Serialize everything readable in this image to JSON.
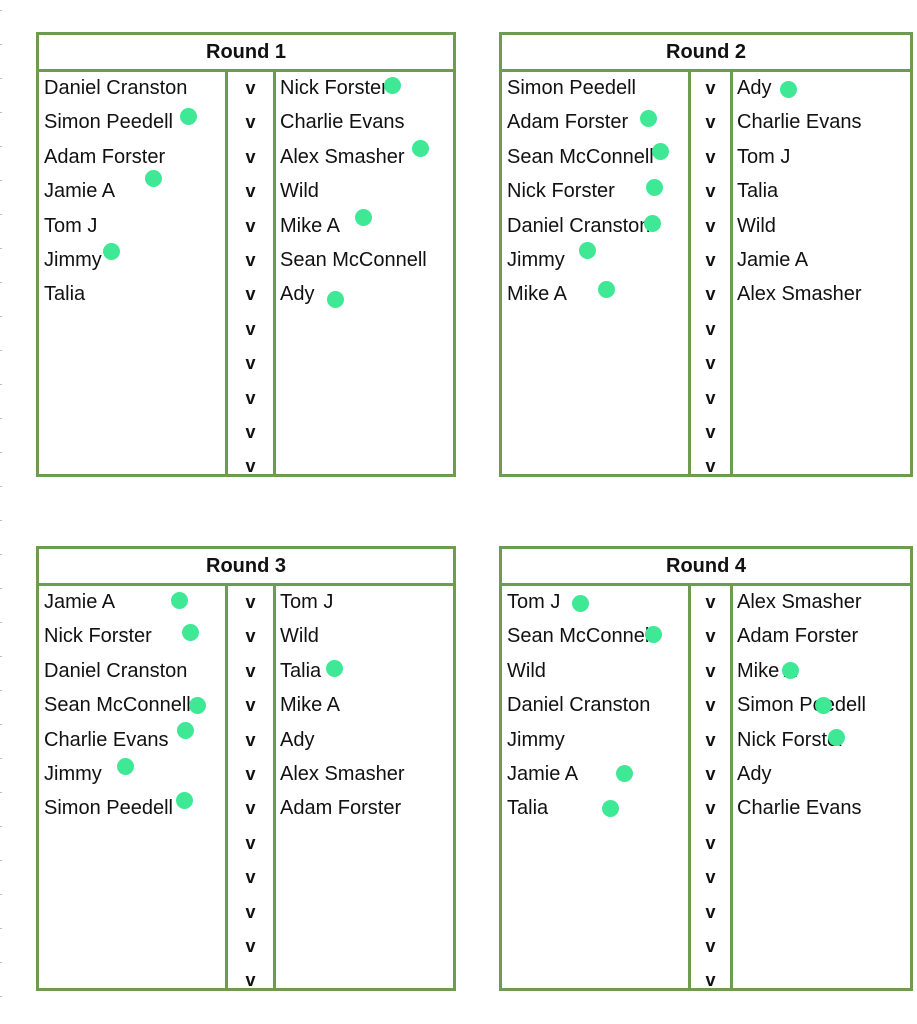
{
  "rounds": [
    {
      "title": "Round 1",
      "matches": [
        {
          "left": "Daniel Cranston",
          "right": "Nick Forster",
          "winner": "right"
        },
        {
          "left": "Simon Peedell",
          "right": "Charlie Evans",
          "winner": "left"
        },
        {
          "left": "Adam Forster",
          "right": "Alex Smasher",
          "winner": "right"
        },
        {
          "left": "Jamie A",
          "right": "Wild",
          "winner": "left"
        },
        {
          "left": "Tom J",
          "right": "Mike A",
          "winner": "right"
        },
        {
          "left": "Jimmy",
          "right": "Sean McConnell",
          "winner": "left"
        },
        {
          "left": "Talia",
          "right": "Ady",
          "winner": "right"
        }
      ]
    },
    {
      "title": "Round 2",
      "matches": [
        {
          "left": "Simon Peedell",
          "right": "Ady",
          "winner": "right"
        },
        {
          "left": "Adam Forster",
          "right": "Charlie Evans",
          "winner": "left"
        },
        {
          "left": "Sean McConnell",
          "right": "Tom J",
          "winner": "left"
        },
        {
          "left": "Nick Forster",
          "right": "Talia",
          "winner": "left"
        },
        {
          "left": "Daniel Cranston",
          "right": "Wild",
          "winner": "left"
        },
        {
          "left": "Jimmy",
          "right": "Jamie A",
          "winner": "left"
        },
        {
          "left": "Mike A",
          "right": "Alex Smasher",
          "winner": "left"
        }
      ]
    },
    {
      "title": "Round 3",
      "matches": [
        {
          "left": "Jamie A",
          "right": "Tom J",
          "winner": "left"
        },
        {
          "left": "Nick Forster",
          "right": "Wild",
          "winner": "left"
        },
        {
          "left": "Daniel Cranston",
          "right": "Talia",
          "winner": "right"
        },
        {
          "left": "Sean McConnell",
          "right": "Mike A",
          "winner": "left"
        },
        {
          "left": "Charlie Evans",
          "right": "Ady",
          "winner": "left"
        },
        {
          "left": "Jimmy",
          "right": "Alex Smasher",
          "winner": "left"
        },
        {
          "left": "Simon Peedell",
          "right": "Adam Forster",
          "winner": "left"
        }
      ]
    },
    {
      "title": "Round 4",
      "matches": [
        {
          "left": "Tom J",
          "right": "Alex Smasher",
          "winner": "left"
        },
        {
          "left": "Sean McConnell",
          "right": "Adam Forster",
          "winner": "left"
        },
        {
          "left": "Wild",
          "right": "Mike A",
          "winner": "right"
        },
        {
          "left": "Daniel Cranston",
          "right": "Simon Peedell",
          "winner": "right"
        },
        {
          "left": "Jimmy",
          "right": "Nick Forster",
          "winner": "right"
        },
        {
          "left": "Jamie A",
          "right": "Ady",
          "winner": "left"
        },
        {
          "left": "Talia",
          "right": "Charlie Evans",
          "winner": "left"
        }
      ]
    }
  ],
  "versus_label": "v",
  "colors": {
    "border": "#6d9b50",
    "winner_dot": "#3ee895"
  }
}
